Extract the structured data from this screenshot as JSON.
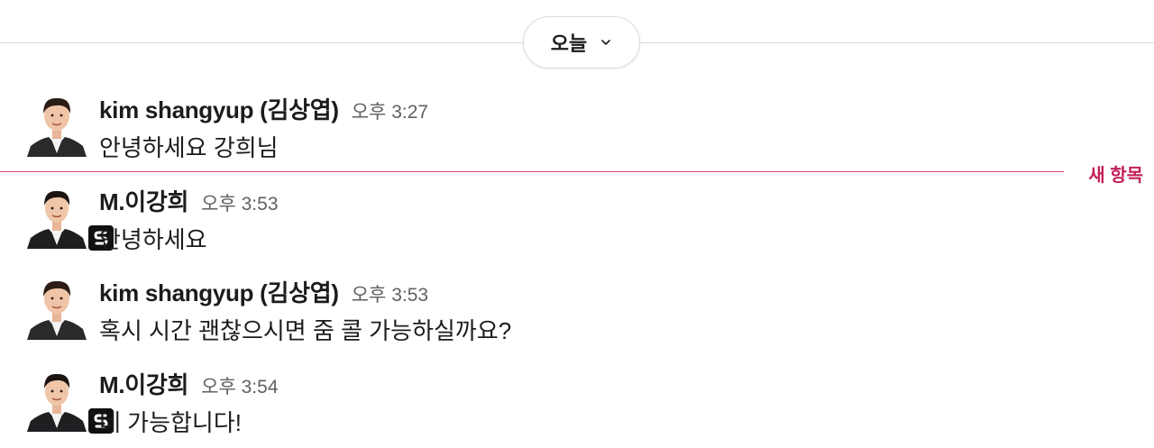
{
  "day_divider": {
    "label": "오늘"
  },
  "new_items_label": "새 항목",
  "messages": [
    {
      "author": "kim shangyup (김상엽)",
      "time": "오후 3:27",
      "text": "안녕하세요 강희님"
    },
    {
      "author": "M.이강희",
      "time": "오후 3:53",
      "text": "안녕하세요"
    },
    {
      "author": "kim shangyup (김상엽)",
      "time": "오후 3:53",
      "text": "혹시 시간 괜찮으시면 줌 콜 가능하실까요?"
    },
    {
      "author": "M.이강희",
      "time": "오후 3:54",
      "text": "네 가능합니다!"
    }
  ],
  "colors": {
    "new_items": "#c21f59",
    "timestamp": "#616061",
    "text": "#1d1c1d"
  }
}
